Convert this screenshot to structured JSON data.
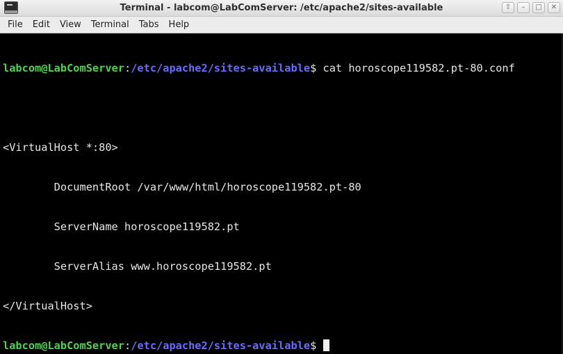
{
  "window": {
    "title": "Terminal - labcom@LabComServer: /etc/apache2/sites-available",
    "controls": [
      "⇧",
      "–",
      "□",
      "✕"
    ]
  },
  "menu": {
    "items": [
      "File",
      "Edit",
      "View",
      "Terminal",
      "Tabs",
      "Help"
    ]
  },
  "terminal": {
    "prompt_user": "labcom@LabComServer",
    "prompt_sep": ":",
    "prompt_path": "/etc/apache2/sites-available",
    "prompt_symbol": "$",
    "command": " cat horoscope119582.pt-80.conf",
    "output": [
      "",
      "<VirtualHost *:80>",
      "        DocumentRoot /var/www/html/horoscope119582.pt-80",
      "        ServerName horoscope119582.pt",
      "        ServerAlias www.horoscope119582.pt",
      "</VirtualHost>"
    ]
  },
  "colors": {
    "background": "#000000",
    "text": "#e6e6e6",
    "prompt_user": "#4fd24f",
    "prompt_path": "#6b6bff"
  }
}
